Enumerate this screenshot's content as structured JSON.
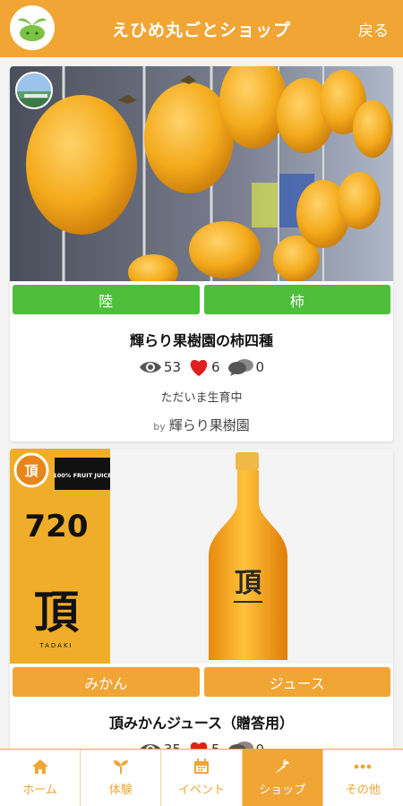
{
  "header": {
    "title": "えひめ丸ごとショップ",
    "back_label": "戻る",
    "logo_icon": "sprout-logo-icon"
  },
  "colors": {
    "brand": "#f0a535",
    "green_tag": "#4dbf3b",
    "heart": "#e02020"
  },
  "cards": [
    {
      "image": "persimmons-hanging-photo",
      "tags": [
        "陸",
        "柿"
      ],
      "tag_color": "green",
      "title": "輝らり果樹園の柿四種",
      "views": "53",
      "likes": "6",
      "comments": "0",
      "status": "ただいま生育中",
      "by": "by",
      "author": "輝らり果樹園"
    },
    {
      "image": "orange-juice-bottle-photo",
      "label_number": "720",
      "label_kanji": "頂",
      "label_small": "100% FRUIT JUICE",
      "label_brand": "TADAKI",
      "bottle_kanji": "頂",
      "tags": [
        "みかん",
        "ジュース"
      ],
      "tag_color": "orange",
      "title": "頂みかんジュース（贈答用）",
      "views": "35",
      "likes": "5",
      "comments": "0"
    }
  ],
  "nav": [
    {
      "label": "ホーム",
      "icon": "home-icon",
      "active": false
    },
    {
      "label": "体験",
      "icon": "sprout-icon",
      "active": false
    },
    {
      "label": "イベント",
      "icon": "calendar-icon",
      "active": false
    },
    {
      "label": "ショップ",
      "icon": "carrot-icon",
      "active": true
    },
    {
      "label": "その他",
      "icon": "more-dots-icon",
      "active": false
    }
  ]
}
